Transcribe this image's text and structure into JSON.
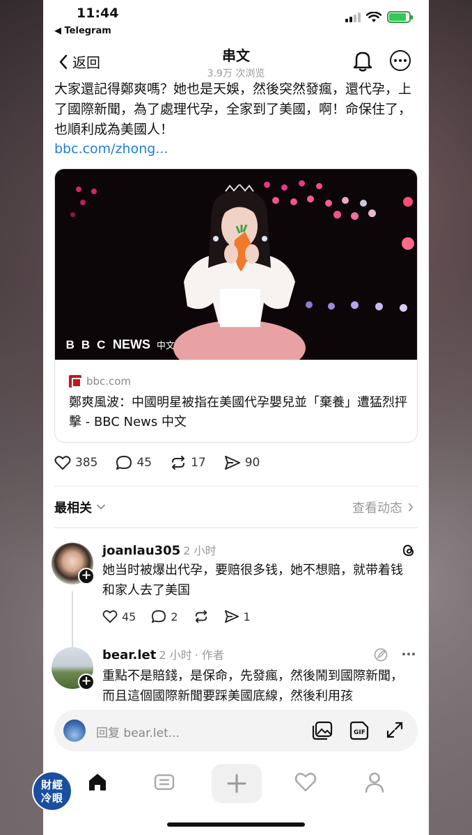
{
  "status_bar": {
    "time": "11:44",
    "back_app": "◀ Telegram"
  },
  "header": {
    "back_label": "返回",
    "title": "串文",
    "views": "3.9万 次浏览"
  },
  "post": {
    "text": "大家還記得鄭爽嗎？她也是天娛，然後突然發瘋，還代孕，上了國際新聞，為了處理代孕，全家到了美國，啊！命保住了，也順利成為美國人！",
    "link": "bbc.com/zhong...",
    "card": {
      "image_logo": "BBC",
      "image_logo_news": "NEWS",
      "image_logo_lang": "中文",
      "source": "bbc.com",
      "title": "鄭爽風波：中國明星被指在美國代孕嬰兒並「棄養」遭猛烈抨擊 - BBC News 中文"
    },
    "stats": {
      "likes": "385",
      "comments": "45",
      "reposts": "17",
      "shares": "90"
    }
  },
  "sort": {
    "label": "最相关",
    "view_activity": "查看动态"
  },
  "comments": [
    {
      "username": "joanlau305",
      "time": "2 小时",
      "text": "她当时被爆出代孕，要赔很多钱，她不想赔，就带着钱和家人去了美国",
      "likes": "45",
      "replies": "2",
      "shares": "1"
    },
    {
      "username": "bear.let",
      "time": "2 小时",
      "author_tag": "· 作者",
      "text": "重點不是賠錢，是保命，先發瘋，然後鬧到國際新聞，而且這個國際新聞要踩美國底線，然後利用孩"
    }
  ],
  "reply_bar": {
    "placeholder": "回复 bear.let..."
  },
  "watermark": {
    "line1": "財經",
    "line2": "冷眼"
  },
  "colors": {
    "link": "#1d7fd8",
    "battery": "#34c759",
    "bbc_red": "#c4161c"
  }
}
